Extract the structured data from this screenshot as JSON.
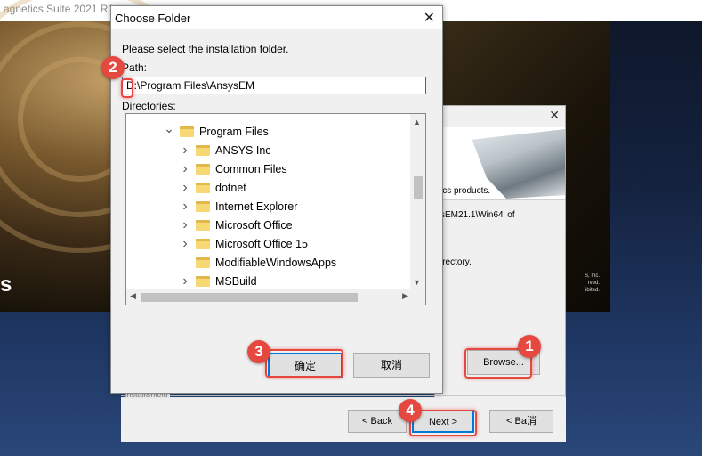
{
  "installer": {
    "title": "agnetics Suite 2021 R1",
    "splash_word": "s",
    "splash_legal": "S, Inc.\nrved.\nibited."
  },
  "wizard": {
    "close_glyph": "✕",
    "line1": "ics products.",
    "line2": "sEM21.1\\Win64' of",
    "line3": "irectory.",
    "browse_label": "Browse...",
    "installshield_label": "InstallShield",
    "back_label": "< Back",
    "next_label": "Next >",
    "cancel_label": "< Ba消"
  },
  "dialog": {
    "title": "Choose Folder",
    "close_glyph": "✕",
    "prompt": "Please select the installation folder.",
    "path_label": "Path:",
    "path_value": "D:\\Program Files\\AnsysEM",
    "directories_label": "Directories:",
    "tree": [
      {
        "label": "Program Files",
        "expanded": true,
        "level": 0
      },
      {
        "label": "ANSYS Inc",
        "expanded": false,
        "level": 1
      },
      {
        "label": "Common Files",
        "expanded": false,
        "level": 1
      },
      {
        "label": "dotnet",
        "expanded": false,
        "level": 1
      },
      {
        "label": "Internet Explorer",
        "expanded": false,
        "level": 1
      },
      {
        "label": "Microsoft Office",
        "expanded": false,
        "level": 1
      },
      {
        "label": "Microsoft Office 15",
        "expanded": false,
        "level": 1
      },
      {
        "label": "ModifiableWindowsApps",
        "expanded": false,
        "level": 1,
        "no_arrow": true
      },
      {
        "label": "MSBuild",
        "expanded": false,
        "level": 1
      }
    ],
    "ok_label": "确定",
    "cancel_label": "取消"
  },
  "markers": [
    "1",
    "2",
    "3",
    "4"
  ],
  "colors": {
    "highlight": "#e5483f",
    "focus": "#0078d7"
  }
}
